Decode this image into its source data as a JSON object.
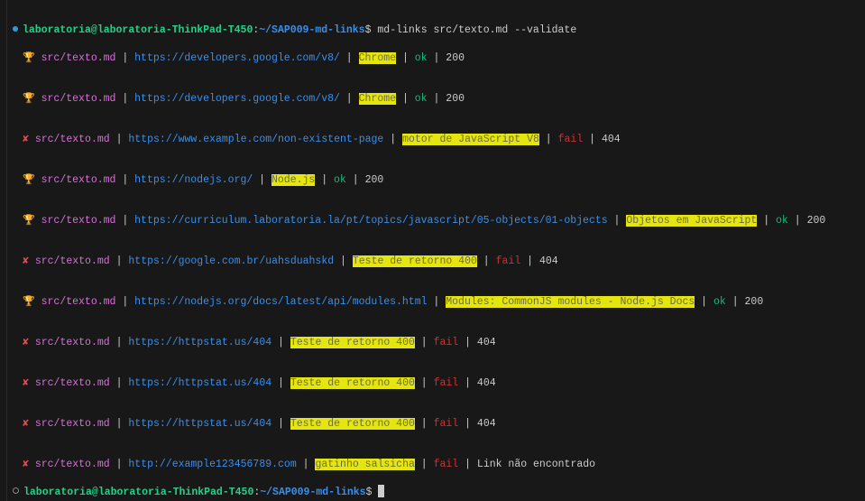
{
  "prompt": {
    "user": "laboratoria@laboratoria-ThinkPad-T450",
    "colon": ":",
    "cwd": "~/SAP009-md-links",
    "symbol": "$"
  },
  "command": "md-links src/texto.md --validate",
  "rows": [
    {
      "status": "ok",
      "icon": "trophy",
      "file": "src/texto.md",
      "url": "https://developers.google.com/v8/",
      "text": "Chrome",
      "result": "ok",
      "code": "200"
    },
    {
      "status": "ok",
      "icon": "trophy",
      "file": "src/texto.md",
      "url": "https://developers.google.com/v8/",
      "text": "Chrome",
      "result": "ok",
      "code": "200"
    },
    {
      "status": "fail",
      "icon": "cross",
      "file": "src/texto.md",
      "url": "https://www.example.com/non-existent-page",
      "text": "motor de JavaScript V8",
      "result": "fail",
      "code": "404"
    },
    {
      "status": "ok",
      "icon": "trophy",
      "file": "src/texto.md",
      "url": "https://nodejs.org/",
      "text": "Node.js",
      "result": "ok",
      "code": "200"
    },
    {
      "status": "ok",
      "icon": "trophy",
      "file": "src/texto.md",
      "url": "https://curriculum.laboratoria.la/pt/topics/javascript/05-objects/01-objects",
      "text": "Objetos em JavaScript",
      "result": "ok",
      "code": "200"
    },
    {
      "status": "fail",
      "icon": "cross",
      "file": "src/texto.md",
      "url": "https://google.com.br/uahsduahskd",
      "text": "Teste de retorno 400",
      "result": "fail",
      "code": "404"
    },
    {
      "status": "ok",
      "icon": "trophy",
      "file": "src/texto.md",
      "url": "https://nodejs.org/docs/latest/api/modules.html",
      "text": "Modules: CommonJS modules - Node.js Docs",
      "result": "ok",
      "code": "200"
    },
    {
      "status": "fail",
      "icon": "cross",
      "file": "src/texto.md",
      "url": "https://httpstat.us/404",
      "text": "Teste de retorno 400",
      "result": "fail",
      "code": "404"
    },
    {
      "status": "fail",
      "icon": "cross",
      "file": "src/texto.md",
      "url": "https://httpstat.us/404",
      "text": "Teste de retorno 400",
      "result": "fail",
      "code": "404"
    },
    {
      "status": "fail",
      "icon": "cross",
      "file": "src/texto.md",
      "url": "https://httpstat.us/404",
      "text": "Teste de retorno 400",
      "result": "fail",
      "code": "404"
    },
    {
      "status": "fail",
      "icon": "cross",
      "file": "src/texto.md",
      "url": "http://example123456789.com",
      "text": "gatinho salsicha",
      "result": "fail",
      "code": "Link não encontrado"
    }
  ],
  "icons": {
    "trophy": "🏆",
    "cross": "✘"
  },
  "colors": {
    "background": "#181818",
    "user": "#23d18b",
    "cwd": "#3b8eea",
    "file": "#d670d6",
    "url": "#3b8eea",
    "highlight": "#e5e510",
    "ok": "#0dbc79",
    "fail": "#cd3131"
  }
}
